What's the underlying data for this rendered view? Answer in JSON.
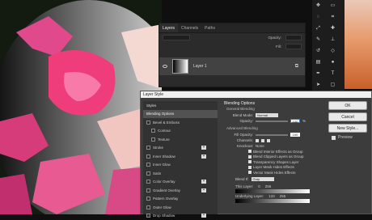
{
  "layers_panel": {
    "tabs": [
      "Layers",
      "Channels",
      "Paths"
    ],
    "opacity_label": "Opacity:",
    "fill_label": "Fill:",
    "layer_name": "Layer 1"
  },
  "dialog": {
    "title": "Layer Style",
    "styles_header": "Styles",
    "styles": [
      {
        "label": "Blending Options",
        "selected": true,
        "checkbox": false,
        "plus": false
      },
      {
        "label": "Bevel & Emboss",
        "selected": false,
        "checkbox": true,
        "plus": false
      },
      {
        "label": "Contour",
        "selected": false,
        "checkbox": true,
        "plus": false,
        "indent": true
      },
      {
        "label": "Texture",
        "selected": false,
        "checkbox": true,
        "plus": false,
        "indent": true
      },
      {
        "label": "Stroke",
        "selected": false,
        "checkbox": true,
        "plus": true
      },
      {
        "label": "Inner Shadow",
        "selected": false,
        "checkbox": true,
        "plus": true
      },
      {
        "label": "Inner Glow",
        "selected": false,
        "checkbox": true,
        "plus": false
      },
      {
        "label": "Satin",
        "selected": false,
        "checkbox": true,
        "plus": false
      },
      {
        "label": "Color Overlay",
        "selected": false,
        "checkbox": true,
        "plus": true
      },
      {
        "label": "Gradient Overlay",
        "selected": false,
        "checkbox": true,
        "plus": true
      },
      {
        "label": "Pattern Overlay",
        "selected": false,
        "checkbox": true,
        "plus": false
      },
      {
        "label": "Outer Glow",
        "selected": false,
        "checkbox": true,
        "plus": false
      },
      {
        "label": "Drop Shadow",
        "selected": false,
        "checkbox": true,
        "plus": true
      }
    ],
    "blending_options": "Blending Options",
    "general_blending": "General Blending",
    "blend_mode_label": "Blend Mode:",
    "blend_mode_value": "Normal",
    "opacity_label": "Opacity:",
    "opacity_value": "100",
    "advanced_blending": "Advanced Blending",
    "fill_opacity_label": "Fill Opacity:",
    "fill_opacity_value": "100",
    "channels_label": "Channels:",
    "knockout_label": "Knockout:",
    "knockout_value": "None",
    "checkboxes": [
      "Blend Interior Effects as Group",
      "Blend Clipped Layers as Group",
      "Transparency Shapes Layer",
      "Layer Mask Hides Effects",
      "Vector Mask Hides Effects"
    ],
    "blend_if_label": "Blend If:",
    "blend_if_value": "Gray",
    "this_layer_label": "This Layer:",
    "this_layer_min": "0",
    "this_layer_max": "255",
    "underlying_label": "Underlying Layer:",
    "underlying_min": "133",
    "underlying_max": "255",
    "buttons": {
      "ok": "OK",
      "cancel": "Cancel",
      "new_style": "New Style...",
      "preview": "Preview"
    }
  },
  "colors": {
    "accent": "#2f7bd6",
    "dialog_bg": "#3c3c3c",
    "panel_bg": "#2b2b2b"
  }
}
